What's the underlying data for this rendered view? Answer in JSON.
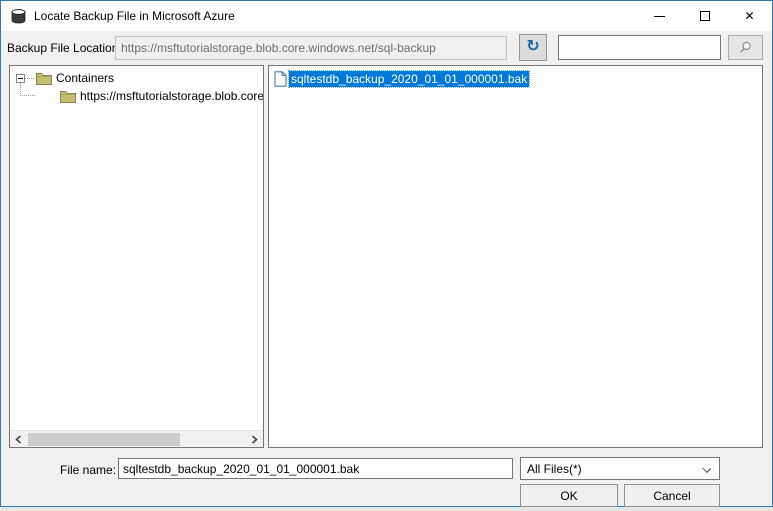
{
  "window": {
    "title": "Locate Backup File in Microsoft Azure"
  },
  "toolbar": {
    "location_label": "Backup File Location",
    "location_value": "https://msftutorialstorage.blob.core.windows.net/sql-backup",
    "search_value": ""
  },
  "tree": {
    "root_label": "Containers",
    "child_label": "https://msftutorialstorage.blob.core.wind"
  },
  "files": {
    "selected_name": "sqltestdb_backup_2020_01_01_000001.bak"
  },
  "footer": {
    "file_name_label": "File name:",
    "file_name_value": "sqltestdb_backup_2020_01_01_000001.bak",
    "file_type_selected": "All Files(*)",
    "ok_label": "OK",
    "cancel_label": "Cancel"
  },
  "icons": {
    "refresh": "↻",
    "close": "✕"
  },
  "colors": {
    "selection": "#0078d7",
    "window_border": "#3279b7",
    "folder": "#c6c06e"
  }
}
